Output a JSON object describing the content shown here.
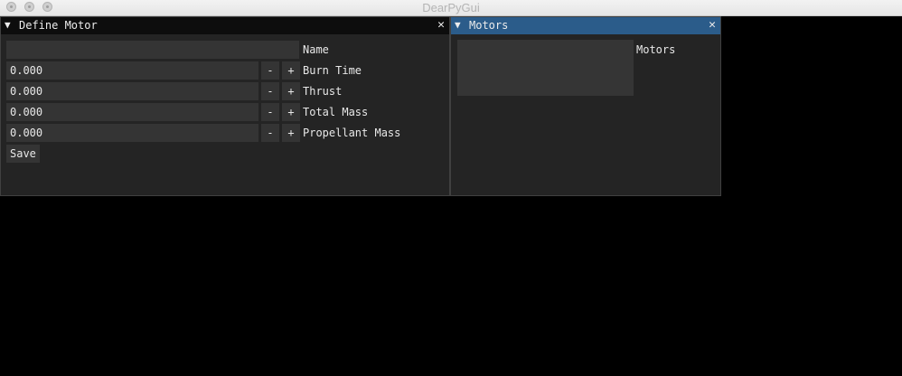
{
  "app": {
    "title": "DearPyGui"
  },
  "define_window": {
    "title": "Define Motor",
    "collapse_glyph": "▼",
    "close_glyph": "✕",
    "name_label": "Name",
    "name_value": "",
    "fields": [
      {
        "label": "Burn Time",
        "value": "0.000"
      },
      {
        "label": "Thrust",
        "value": "0.000"
      },
      {
        "label": "Total Mass",
        "value": "0.000"
      },
      {
        "label": "Propellant Mass",
        "value": "0.000"
      }
    ],
    "minus_label": "-",
    "plus_label": "+",
    "save_label": "Save"
  },
  "motors_window": {
    "title": "Motors",
    "collapse_glyph": "▼",
    "close_glyph": "✕",
    "list_label": "Motors"
  },
  "colors": {
    "window_bg": "#242424",
    "title_bg": "#0d0d0d",
    "title_active": "#2b5c8a",
    "widget_bg": "#343434"
  }
}
